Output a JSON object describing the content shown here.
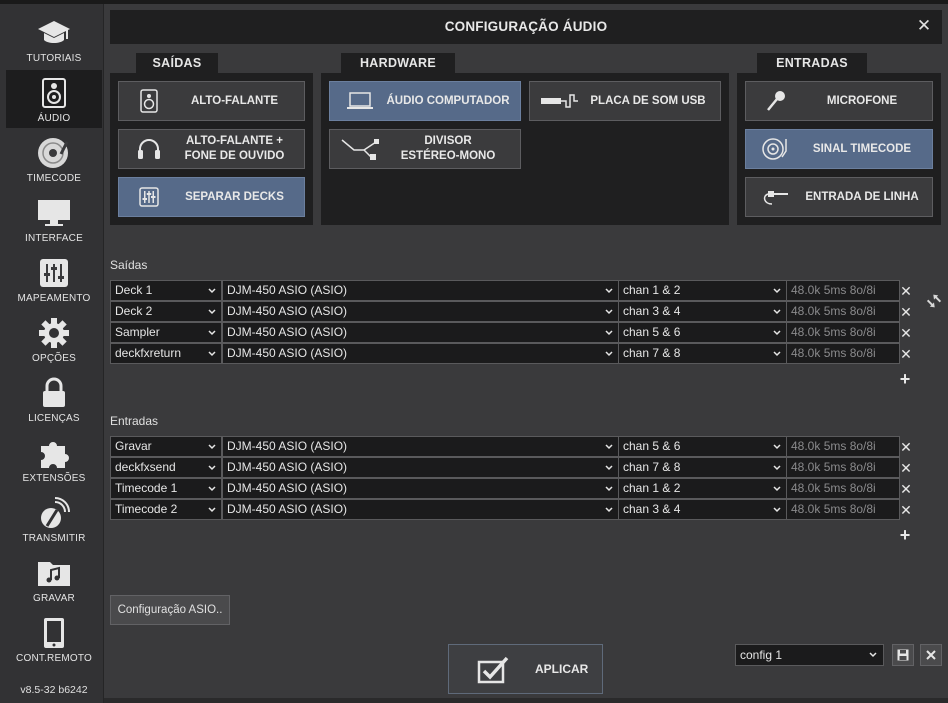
{
  "window": {
    "title": "CONFIGURAÇÃO ÁUDIO",
    "close_glyph": "✕"
  },
  "sidebar": {
    "items": [
      {
        "label": "TUTORIAIS",
        "icon": "graduation-cap-icon",
        "active": false
      },
      {
        "label": "ÁUDIO",
        "icon": "speaker-icon",
        "active": true
      },
      {
        "label": "TIMECODE",
        "icon": "vinyl-disc-icon",
        "active": false
      },
      {
        "label": "INTERFACE",
        "icon": "monitor-icon",
        "active": false
      },
      {
        "label": "MAPEAMENTO",
        "icon": "sliders-icon",
        "active": false
      },
      {
        "label": "OPÇÕES",
        "icon": "gear-icon",
        "active": false
      },
      {
        "label": "LICENÇAS",
        "icon": "lock-icon",
        "active": false
      },
      {
        "label": "EXTENSÕES",
        "icon": "puzzle-icon",
        "active": false
      },
      {
        "label": "TRANSMITIR",
        "icon": "broadcast-icon",
        "active": false
      },
      {
        "label": "GRAVAR",
        "icon": "music-folder-icon",
        "active": false
      },
      {
        "label": "CONT.REMOTO",
        "icon": "tablet-icon",
        "active": false
      }
    ],
    "version": "v8.5-32 b6242"
  },
  "outputs_section": {
    "tab": "SAÍDAS",
    "buttons": [
      {
        "label": "ALTO-FALANTE",
        "icon": "speaker-icon",
        "active": false
      },
      {
        "label": "ALTO-FALANTE +\nFONE DE OUVIDO",
        "label_line1": "ALTO-FALANTE +",
        "label_line2": "FONE DE OUVIDO",
        "icon": "headphones-icon",
        "active": false
      },
      {
        "label": "SEPARAR DECKS",
        "icon": "mixer-icon",
        "active": true
      }
    ]
  },
  "hardware_section": {
    "tab": "HARDWARE",
    "buttons": [
      {
        "label": "ÁUDIO COMPUTADOR",
        "icon": "laptop-icon",
        "active": true
      },
      {
        "label": "PLACA DE SOM USB",
        "icon": "usb-soundcard-icon",
        "active": false
      },
      {
        "label_line1": "DIVISOR",
        "label_line2": "ESTÉREO-MONO",
        "icon": "splitter-cable-icon",
        "active": false
      }
    ]
  },
  "inputs_section": {
    "tab": "ENTRADAS",
    "buttons": [
      {
        "label": "MICROFONE",
        "icon": "microphone-icon",
        "active": false
      },
      {
        "label": "SINAL TIMECODE",
        "icon": "timecode-vinyl-icon",
        "active": true
      },
      {
        "label": "ENTRADA DE LINHA",
        "icon": "line-in-cable-icon",
        "active": false
      }
    ]
  },
  "outputs_table": {
    "label": "Saídas",
    "rows": [
      {
        "name": "Deck 1",
        "device": "DJM-450 ASIO (ASIO)",
        "channel": "chan 1 & 2",
        "info": "48.0k 5ms 8o/8i"
      },
      {
        "name": "Deck 2",
        "device": "DJM-450 ASIO (ASIO)",
        "channel": "chan 3 & 4",
        "info": "48.0k 5ms 8o/8i"
      },
      {
        "name": "Sampler",
        "device": "DJM-450 ASIO (ASIO)",
        "channel": "chan 5 & 6",
        "info": "48.0k 5ms 8o/8i"
      },
      {
        "name": "deckfxreturn",
        "device": "DJM-450 ASIO (ASIO)",
        "channel": "chan 7 & 8",
        "info": "48.0k 5ms 8o/8i"
      }
    ]
  },
  "inputs_table": {
    "label": "Entradas",
    "rows": [
      {
        "name": "Gravar",
        "device": "DJM-450 ASIO (ASIO)",
        "channel": "chan 5 & 6",
        "info": "48.0k 5ms 8o/8i"
      },
      {
        "name": "deckfxsend",
        "device": "DJM-450 ASIO (ASIO)",
        "channel": "chan 7 & 8",
        "info": "48.0k 5ms 8o/8i"
      },
      {
        "name": "Timecode 1",
        "device": "DJM-450 ASIO (ASIO)",
        "channel": "chan 1 & 2",
        "info": "48.0k 5ms 8o/8i"
      },
      {
        "name": "Timecode 2",
        "device": "DJM-450 ASIO (ASIO)",
        "channel": "chan 3 & 4",
        "info": "48.0k 5ms 8o/8i"
      }
    ]
  },
  "footer": {
    "asio_button": "Configuração ASIO..",
    "apply_button": "APLICAR",
    "config_select": "config 1"
  },
  "colors": {
    "active_button": "#566a89",
    "panel": "#1f1f20",
    "background": "#3a3a3c"
  }
}
